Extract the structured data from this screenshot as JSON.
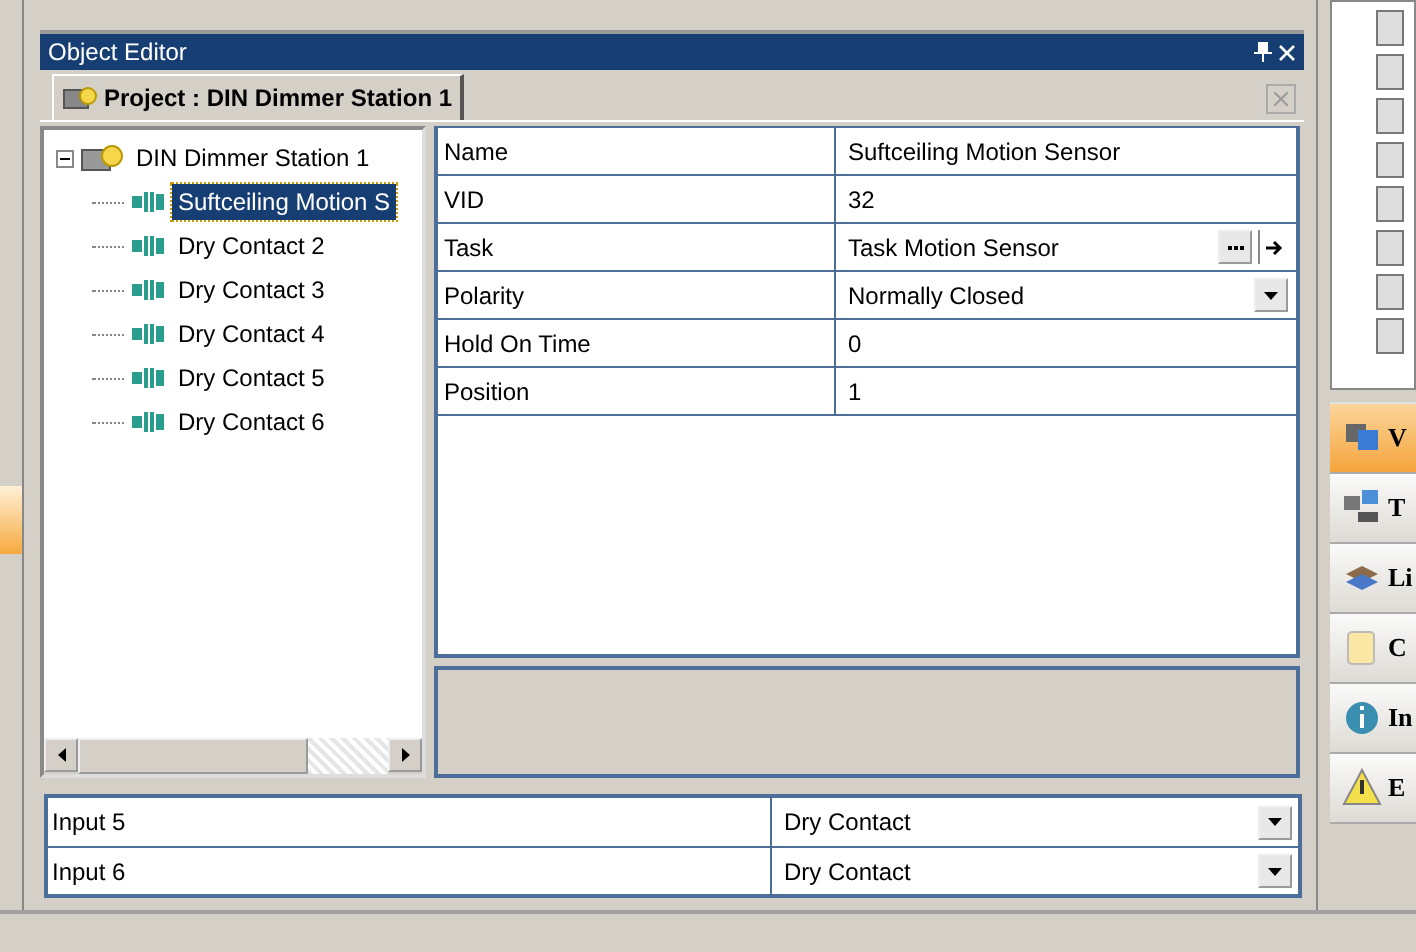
{
  "panel": {
    "title": "Object Editor"
  },
  "tabs": [
    {
      "label": "Project : DIN Dimmer Station 1",
      "selected": true
    }
  ],
  "tree": {
    "label": "DIN Dimmer Station 1",
    "expanded": true,
    "children": [
      {
        "label": "Suftceiling Motion S",
        "selected": true
      },
      {
        "label": "Dry Contact 2",
        "selected": false
      },
      {
        "label": "Dry Contact 3",
        "selected": false
      },
      {
        "label": "Dry Contact 4",
        "selected": false
      },
      {
        "label": "Dry Contact 5",
        "selected": false
      },
      {
        "label": "Dry Contact 6",
        "selected": false
      }
    ]
  },
  "properties": [
    {
      "name": "Name",
      "value": "Suftceiling Motion Sensor",
      "kind": "text"
    },
    {
      "name": "VID",
      "value": "32",
      "kind": "text"
    },
    {
      "name": "Task",
      "value": "Task Motion Sensor",
      "kind": "task"
    },
    {
      "name": "Polarity",
      "value": "Normally Closed",
      "kind": "dropdown"
    },
    {
      "name": "Hold On Time",
      "value": "0",
      "kind": "text"
    },
    {
      "name": "Position",
      "value": "1",
      "kind": "text"
    }
  ],
  "inputs": [
    {
      "name": "Input 5",
      "value": "Dry Contact"
    },
    {
      "name": "Input 6",
      "value": "Dry Contact"
    }
  ],
  "side_nav": [
    {
      "label": "V",
      "selected": true
    },
    {
      "label": "T",
      "selected": false
    },
    {
      "label": "Li",
      "selected": false
    },
    {
      "label": "C",
      "selected": false
    },
    {
      "label": "In",
      "selected": false
    },
    {
      "label": "E",
      "selected": false
    }
  ]
}
